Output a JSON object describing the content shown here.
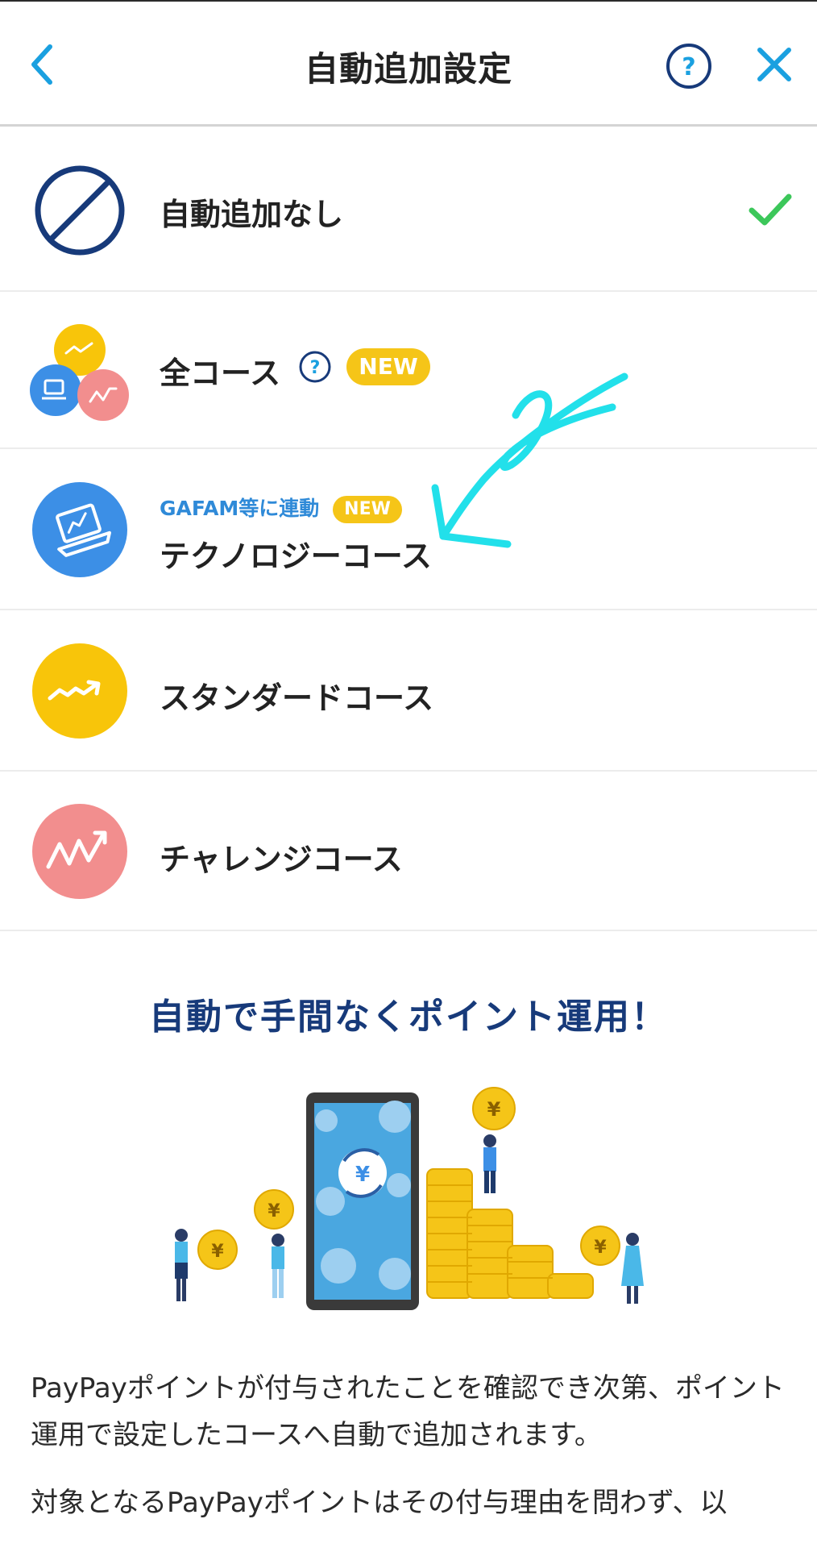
{
  "header": {
    "title": "自動追加設定",
    "back_icon": "chevron-left-icon",
    "help_icon": "question-circle-icon",
    "close_icon": "close-icon"
  },
  "options": [
    {
      "id": "none",
      "label": "自動追加なし",
      "icon": "prohibited-icon",
      "selected": true
    },
    {
      "id": "all",
      "label": "全コース",
      "icon": "all-courses-icon",
      "badge": "NEW",
      "has_help": true
    },
    {
      "id": "technology",
      "label": "テクノロジーコース",
      "subtitle": "GAFAM等に連動",
      "badge": "NEW",
      "icon": "laptop-icon"
    },
    {
      "id": "standard",
      "label": "スタンダードコース",
      "icon": "trend-up-icon"
    },
    {
      "id": "challenge",
      "label": "チャレンジコース",
      "icon": "zigzag-up-icon"
    }
  ],
  "promo": {
    "title": "自動で手間なくポイント運用！",
    "illustration_icon": "phone-coins-illustration"
  },
  "description": [
    "PayPayポイントが付与されたことを確認でき次第、ポイント運用で設定したコースへ自動で追加されます。",
    "対象となるPayPayポイントはその付与理由を問わず、以"
  ],
  "colors": {
    "accent_blue": "#1aa0e0",
    "navy": "#173a7a",
    "check_green": "#3cc75a",
    "badge_yellow": "#f5c518",
    "technology_blue": "#3c8fe6",
    "standard_yellow": "#f8c50a",
    "challenge_pink": "#f28e8e",
    "annotation_cyan": "#22e0ea"
  }
}
